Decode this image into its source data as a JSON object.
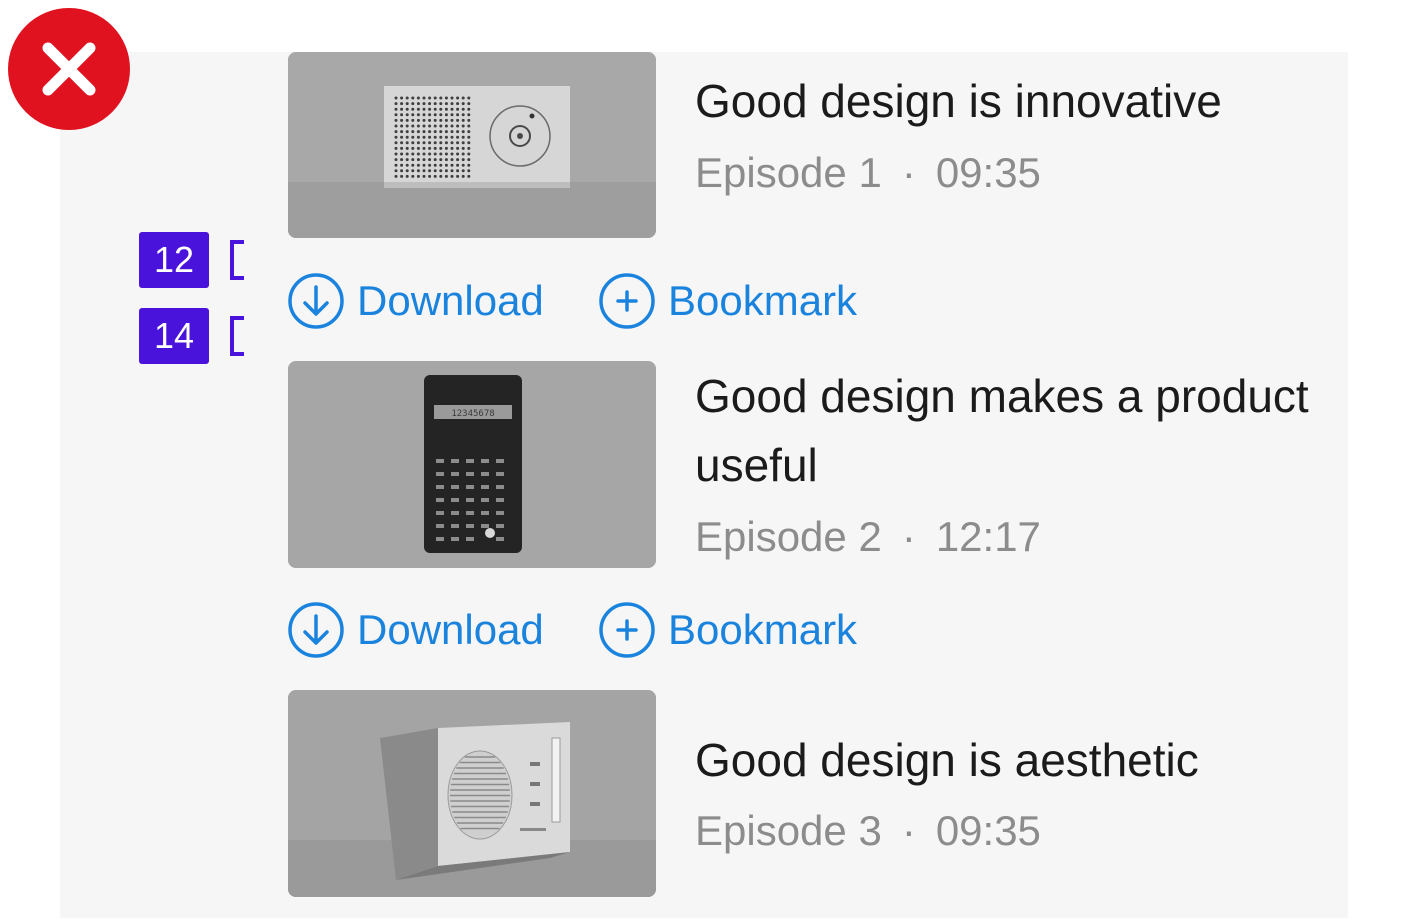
{
  "episodes": [
    {
      "title": "Good design is innovative",
      "episode": "Episode 1",
      "separator": "·",
      "duration": "09:35",
      "thumbnail": "radio-speaker-thumbnail"
    },
    {
      "title": "Good design makes a product useful",
      "episode": "Episode 2",
      "separator": "·",
      "duration": "12:17",
      "thumbnail": "calculator-thumbnail"
    },
    {
      "title": "Good design is aesthetic",
      "episode": "Episode 3",
      "separator": "·",
      "duration": "09:35",
      "thumbnail": "table-radio-thumbnail"
    }
  ],
  "actions": {
    "download_label": "Download",
    "bookmark_label": "Bookmark",
    "download_icon": "arrow-down-circle-icon",
    "bookmark_icon": "plus-circle-icon"
  },
  "annotations": {
    "spacing_a": "12",
    "spacing_b": "14",
    "status_icon": "error-x-icon"
  },
  "colors": {
    "accent": "#1a83de",
    "annotation": "#4a13dc",
    "error": "#e0121f",
    "title": "#1b1b1b",
    "meta": "#8c8c8c",
    "panel": "#f6f6f6"
  },
  "lcd_text": "12345678"
}
